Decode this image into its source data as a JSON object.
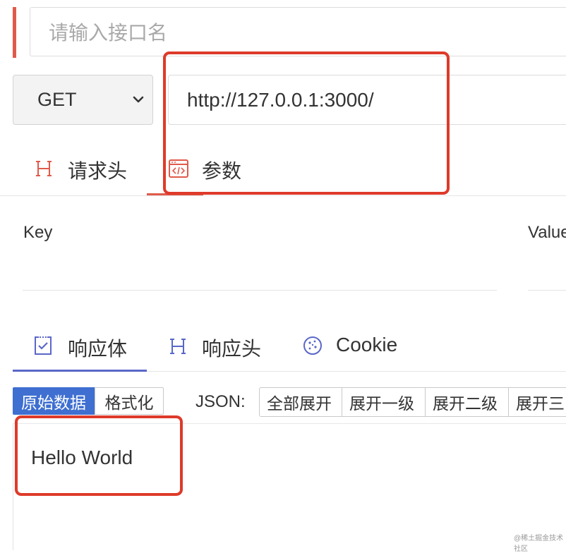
{
  "request": {
    "name_placeholder": "请输入接口名",
    "method": "GET",
    "url": "http://127.0.0.1:3000/"
  },
  "request_tabs": [
    {
      "label": "请求头",
      "icon": "header-h-icon"
    },
    {
      "label": "参数",
      "icon": "code-window-icon",
      "active": true
    }
  ],
  "params": {
    "key_header": "Key",
    "value_header": "Value"
  },
  "response_tabs": [
    {
      "label": "响应体",
      "icon": "checkbox-doc-icon",
      "active": true
    },
    {
      "label": "响应头",
      "icon": "header-h-icon"
    },
    {
      "label": "Cookie",
      "icon": "cookie-icon"
    }
  ],
  "format_toolbar": {
    "raw": "原始数据",
    "pretty": "格式化",
    "json_label": "JSON:",
    "buttons": [
      "全部展开",
      "展开一级",
      "展开二级",
      "展开三"
    ]
  },
  "response_body": "Hello World",
  "watermark": "@稀土掘金技术社区",
  "colors": {
    "accent_red": "#e05a4a",
    "accent_blue": "#5a67c8",
    "button_blue": "#3e6fd1",
    "annotation_red": "#de3a2a"
  }
}
